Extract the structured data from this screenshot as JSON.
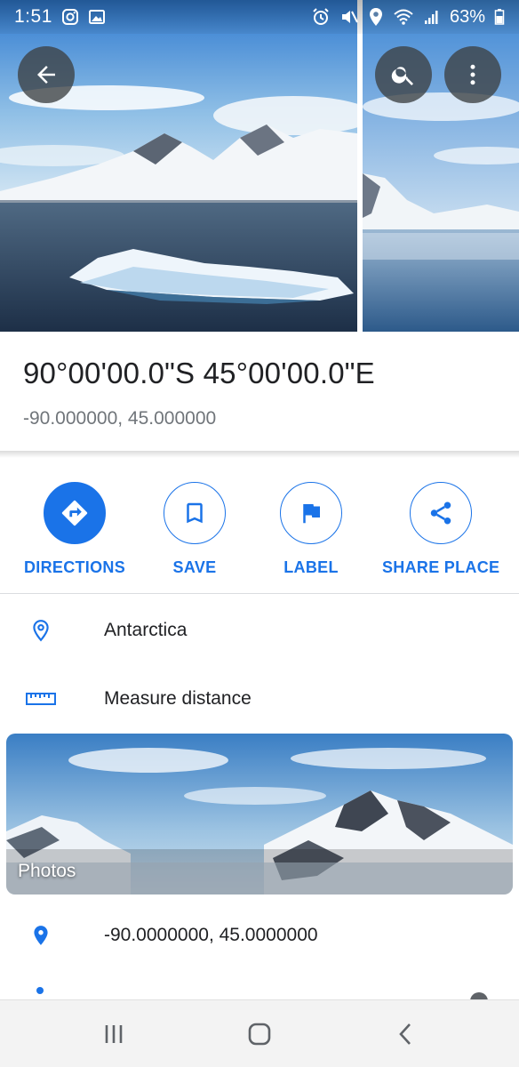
{
  "status_bar": {
    "time": "1:51",
    "battery_percent": "63%",
    "left_icons": [
      "instagram-icon",
      "gallery-icon"
    ],
    "right_icons": [
      "alarm-icon",
      "mute-icon",
      "location-icon",
      "wifi-icon",
      "signal-icon",
      "battery-icon"
    ]
  },
  "top_bar": {
    "buttons": [
      "back-arrow-icon",
      "search-icon",
      "more-vert-icon"
    ]
  },
  "place": {
    "title": "90°00'00.0\"S 45°00'00.0\"E",
    "subtitle": "-90.000000, 45.000000"
  },
  "actions": [
    {
      "label": "DIRECTIONS",
      "icon": "directions-icon",
      "primary": true
    },
    {
      "label": "SAVE",
      "icon": "bookmark-icon",
      "primary": false
    },
    {
      "label": "LABEL",
      "icon": "flag-icon",
      "primary": false
    },
    {
      "label": "SHARE PLACE",
      "icon": "share-icon",
      "primary": false
    }
  ],
  "info": {
    "address": "Antarctica",
    "measure": "Measure distance",
    "coordinates": "-90.0000000, 45.0000000"
  },
  "photos": {
    "label": "Photos"
  },
  "colors": {
    "accent": "#1a73e8",
    "text_primary": "#202124",
    "text_secondary": "#70757a"
  },
  "nav_bar": {
    "buttons": [
      "recent-apps-icon",
      "home-icon",
      "back-icon"
    ]
  }
}
